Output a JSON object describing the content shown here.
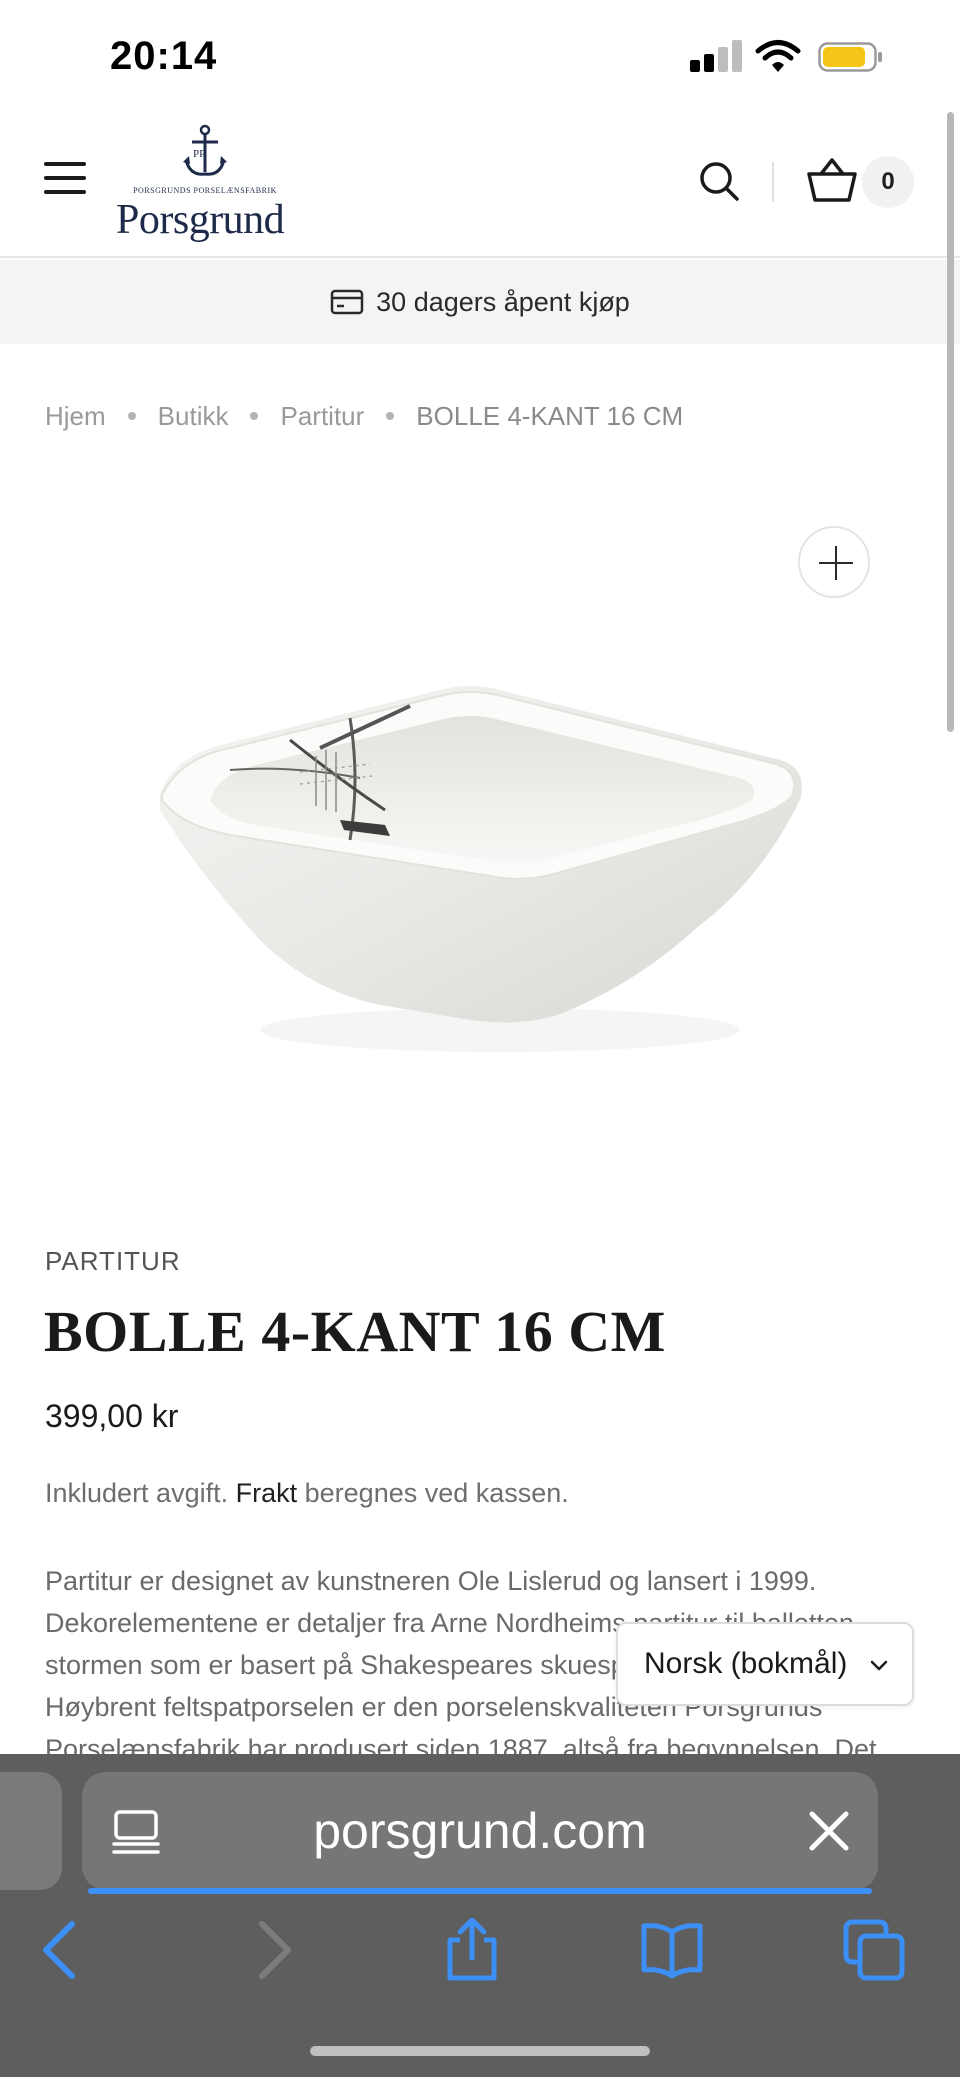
{
  "status_bar": {
    "time": "20:14"
  },
  "header": {
    "logo_tagline": "PORSGRUNDS PORSELÆNSFABRIK",
    "logo_name": "Porsgrund",
    "logo_monogram": "PP",
    "cart_count": "0"
  },
  "promo": {
    "text": "30 dagers åpent kjøp"
  },
  "breadcrumb": {
    "home": "Hjem",
    "shop": "Butikk",
    "collection": "Partitur",
    "current": "BOLLE 4-KANT 16 CM"
  },
  "product": {
    "collection": "PARTITUR",
    "title": "BOLLE 4-KANT 16 CM",
    "price": "399,00 kr",
    "tax_before": "Inkludert avgift.",
    "tax_link": "Frakt",
    "tax_after": "beregnes ved kassen.",
    "description": "Partitur er designet av kunstneren Ole Lislerud og lansert i 1999. Dekorelementene er detaljer fra Arne Nordheims partitur til balletten stormen som er basert på Shakespeares skuespill med samme tittel. Høybrent feltspatporselen er den porselenskvaliteten Porsgrunds Porselænsfabrik har produsert siden 1887, altså fra begynnelsen. Det"
  },
  "language_selector": {
    "selected": "Norsk (bokmål)"
  },
  "browser": {
    "url": "porsgrund.com"
  },
  "colors": {
    "logo_navy": "#1e2a4a",
    "browser_accent": "#3b8ff5",
    "battery": "#f5c518"
  }
}
